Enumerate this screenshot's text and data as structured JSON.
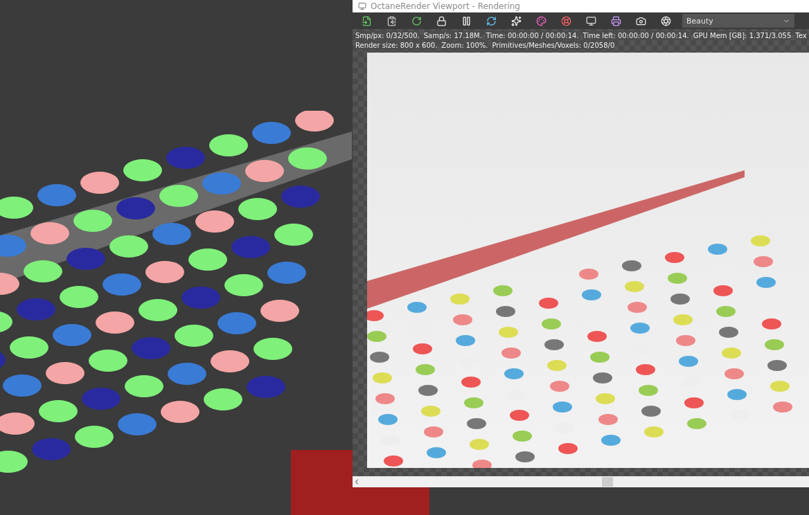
{
  "window": {
    "title": "OctaneRender Viewport - Rendering"
  },
  "toolbar": {
    "dropdown": {
      "value": "Beauty"
    }
  },
  "status_lines": [
    [
      "Smp/px: 0/32/500.",
      "Samp/s: 17.18M.",
      "Time: 00:00:00 / 00:00:14.",
      "Time left: 00:00:00 / 00:00:14.",
      "GPU Mem [GB]: 1.371/3.055",
      "Tex"
    ],
    [
      "Render size: 800 x 600.",
      "Zoom: 100%.",
      "Primitives/Meshes/Voxels: 0/2058/0"
    ]
  ]
}
